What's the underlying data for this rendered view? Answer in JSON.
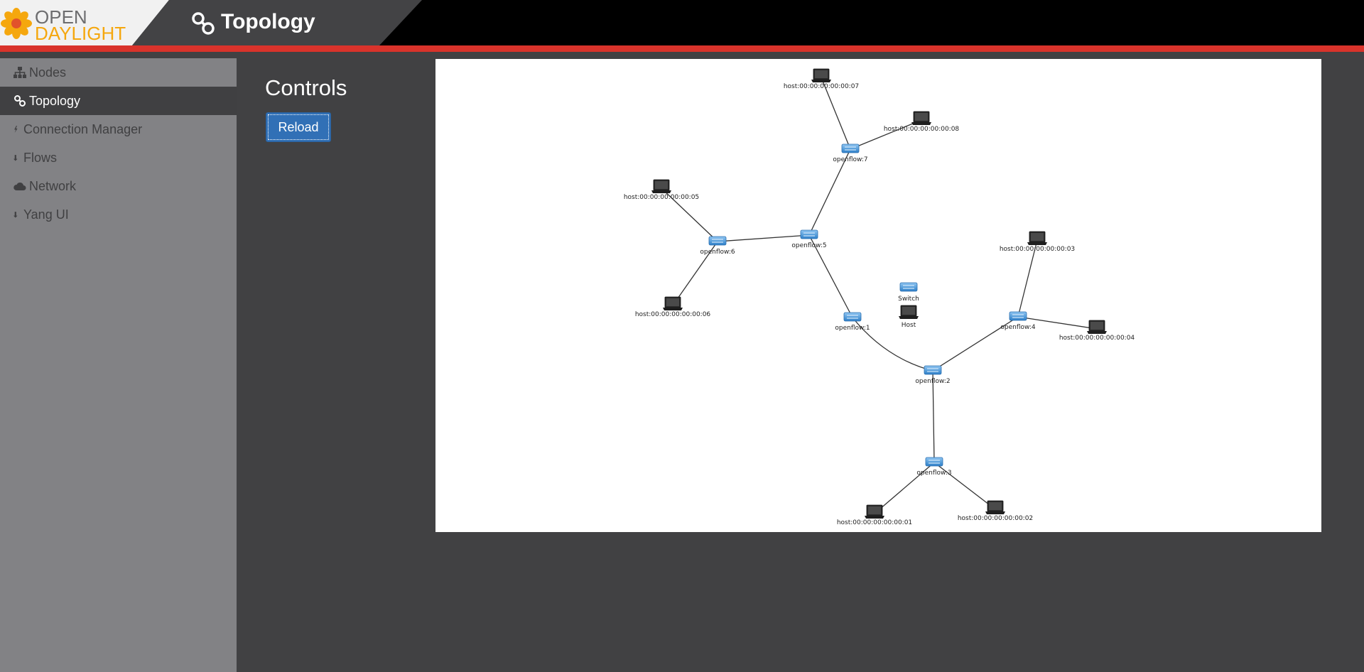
{
  "header": {
    "logo_open": "OPEN",
    "logo_daylight": "DAYLIGHT",
    "title": "Topology"
  },
  "sidebar": {
    "items": [
      {
        "label": "Nodes",
        "icon": "sitemap-icon",
        "active": false
      },
      {
        "label": "Topology",
        "icon": "topology-icon",
        "active": true
      },
      {
        "label": "Connection Manager",
        "icon": "bolt-icon",
        "active": false
      },
      {
        "label": "Flows",
        "icon": "flow-arrow-icon",
        "active": false
      },
      {
        "label": "Network",
        "icon": "cloud-icon",
        "active": false
      },
      {
        "label": "Yang UI",
        "icon": "flow-arrow-icon",
        "active": false
      }
    ]
  },
  "controls": {
    "title": "Controls",
    "reload_label": "Reload"
  },
  "colors": {
    "accent_red": "#d9332b",
    "logo_orange": "#f5a70e",
    "button_blue": "#3170b6",
    "switch_blue": "#3d8fd6"
  },
  "topology": {
    "legend": {
      "switch_label": "Switch",
      "host_label": "Host"
    },
    "nodes": [
      {
        "id": "h7",
        "type": "host",
        "label": "host:00:00:00:00:00:07"
      },
      {
        "id": "h8",
        "type": "host",
        "label": "host:00:00:00:00:00:08"
      },
      {
        "id": "s7",
        "type": "switch",
        "label": "openflow:7"
      },
      {
        "id": "h5",
        "type": "host",
        "label": "host:00:00:00:00:00:05"
      },
      {
        "id": "s6",
        "type": "switch",
        "label": "openflow:6"
      },
      {
        "id": "s5",
        "type": "switch",
        "label": "openflow:5"
      },
      {
        "id": "h6",
        "type": "host",
        "label": "host:00:00:00:00:00:06"
      },
      {
        "id": "h3",
        "type": "host",
        "label": "host:00:00:00:00:00:03"
      },
      {
        "id": "s1",
        "type": "switch",
        "label": "openflow:1"
      },
      {
        "id": "s4",
        "type": "switch",
        "label": "openflow:4"
      },
      {
        "id": "h4",
        "type": "host",
        "label": "host:00:00:00:00:00:04"
      },
      {
        "id": "s2",
        "type": "switch",
        "label": "openflow:2"
      },
      {
        "id": "s3",
        "type": "switch",
        "label": "openflow:3"
      },
      {
        "id": "h1",
        "type": "host",
        "label": "host:00:00:00:00:00:01"
      },
      {
        "id": "h2",
        "type": "host",
        "label": "host:00:00:00:00:00:02"
      }
    ],
    "links": [
      [
        "h7",
        "s7"
      ],
      [
        "h8",
        "s7"
      ],
      [
        "s7",
        "s5"
      ],
      [
        "s5",
        "s6"
      ],
      [
        "h5",
        "s6"
      ],
      [
        "h6",
        "s6"
      ],
      [
        "s5",
        "s1"
      ],
      [
        "s1",
        "s2"
      ],
      [
        "s2",
        "s4"
      ],
      [
        "s4",
        "h3"
      ],
      [
        "s4",
        "h4"
      ],
      [
        "s2",
        "s3"
      ],
      [
        "s3",
        "h1"
      ],
      [
        "s3",
        "h2"
      ]
    ]
  }
}
